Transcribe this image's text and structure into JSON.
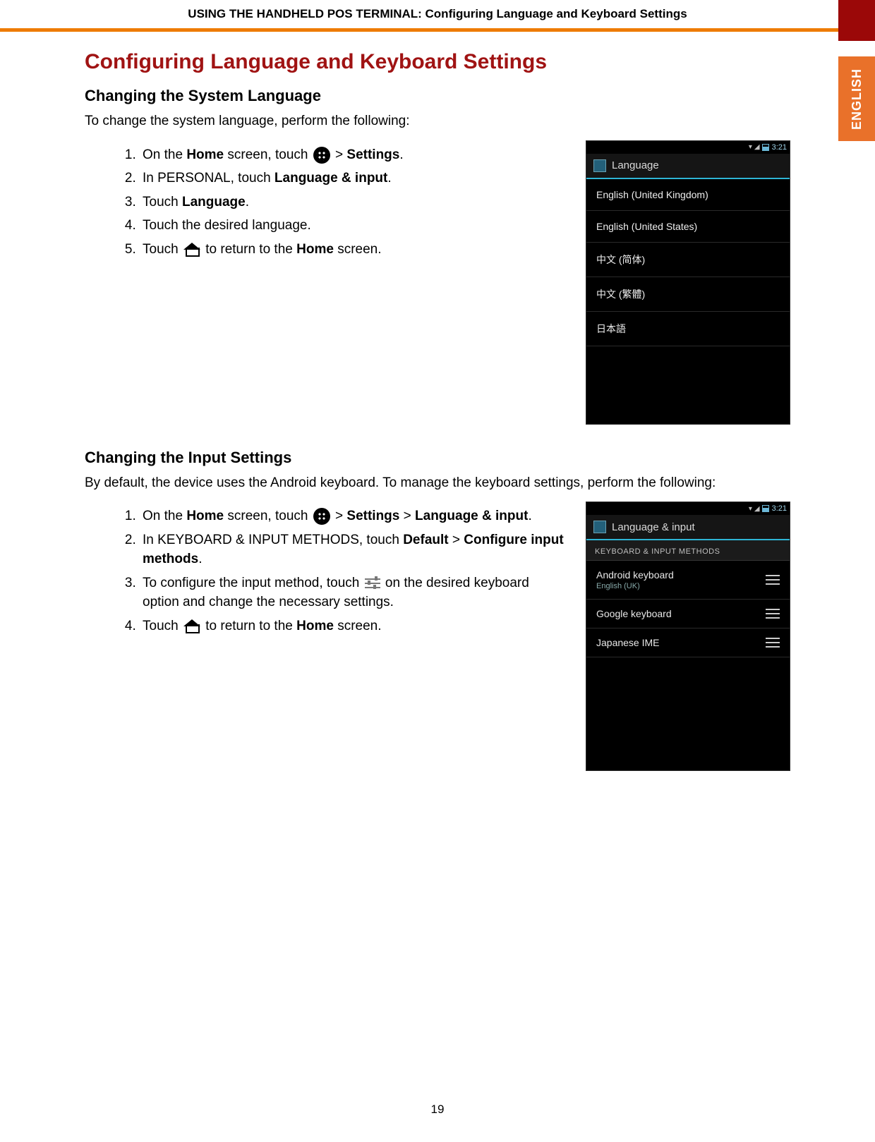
{
  "header": {
    "running_head": "USING THE HANDHELD POS TERMINAL: Configuring Language and Keyboard Settings",
    "side_tab": "ENGLISH"
  },
  "title": "Configuring Language and Keyboard Settings",
  "section1": {
    "heading": "Changing the System Language",
    "intro": "To change the system language, perform the following:",
    "steps": {
      "s1a": "On the ",
      "s1b": "Home",
      "s1c": " screen, touch ",
      "s1d": " > ",
      "s1e": "Settings",
      "s1f": ".",
      "s2a": "In PERSONAL, touch ",
      "s2b": "Language & input",
      "s2c": ".",
      "s3a": "Touch ",
      "s3b": "Language",
      "s3c": ".",
      "s4": "Touch the desired language.",
      "s5a": "Touch ",
      "s5b": " to return to the ",
      "s5c": "Home",
      "s5d": " screen."
    }
  },
  "phone1": {
    "clock": "3:21",
    "title": "Language",
    "items": [
      "English (United Kingdom)",
      "English (United States)",
      "中文 (简体)",
      "中文 (繁體)",
      "日本語"
    ]
  },
  "section2": {
    "heading": "Changing the Input Settings",
    "intro": "By default, the device uses the Android keyboard. To manage the keyboard settings, perform the following:",
    "steps": {
      "s1a": "On the ",
      "s1b": "Home",
      "s1c": " screen, touch ",
      "s1d": " > ",
      "s1e": "Settings",
      "s1f": " > ",
      "s1g": "Language & input",
      "s1h": ".",
      "s2a": "In KEYBOARD & INPUT METHODS, touch ",
      "s2b": "Default",
      "s2c": " > ",
      "s2d": "Configure input methods",
      "s2e": ".",
      "s3a": "To configure the input method, touch ",
      "s3b": " on the desired keyboard option and change the necessary settings.",
      "s4a": "Touch ",
      "s4b": " to return to the ",
      "s4c": "Home",
      "s4d": " screen."
    }
  },
  "phone2": {
    "clock": "3:21",
    "title": "Language & input",
    "section_header": "KEYBOARD & INPUT METHODS",
    "items": [
      {
        "name": "Android keyboard",
        "sub": "English (UK)"
      },
      {
        "name": "Google keyboard",
        "sub": ""
      },
      {
        "name": "Japanese IME",
        "sub": ""
      }
    ]
  },
  "page_number": "19"
}
